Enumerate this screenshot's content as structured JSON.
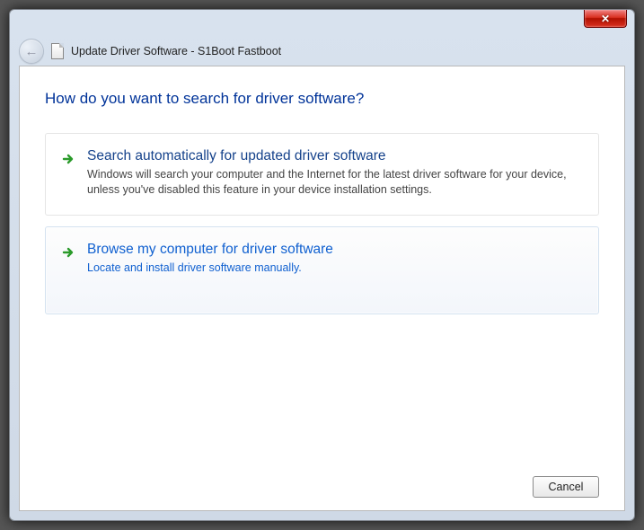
{
  "titlebar": {
    "close_glyph": "✕"
  },
  "breadcrumb": {
    "title": "Update Driver Software - S1Boot Fastboot"
  },
  "heading": "How do you want to search for driver software?",
  "options": [
    {
      "title": "Search automatically for updated driver software",
      "desc": "Windows will search your computer and the Internet for the latest driver software for your device, unless you've disabled this feature in your device installation settings."
    },
    {
      "title": "Browse my computer for driver software",
      "desc": "Locate and install driver software manually."
    }
  ],
  "footer": {
    "cancel_label": "Cancel"
  }
}
